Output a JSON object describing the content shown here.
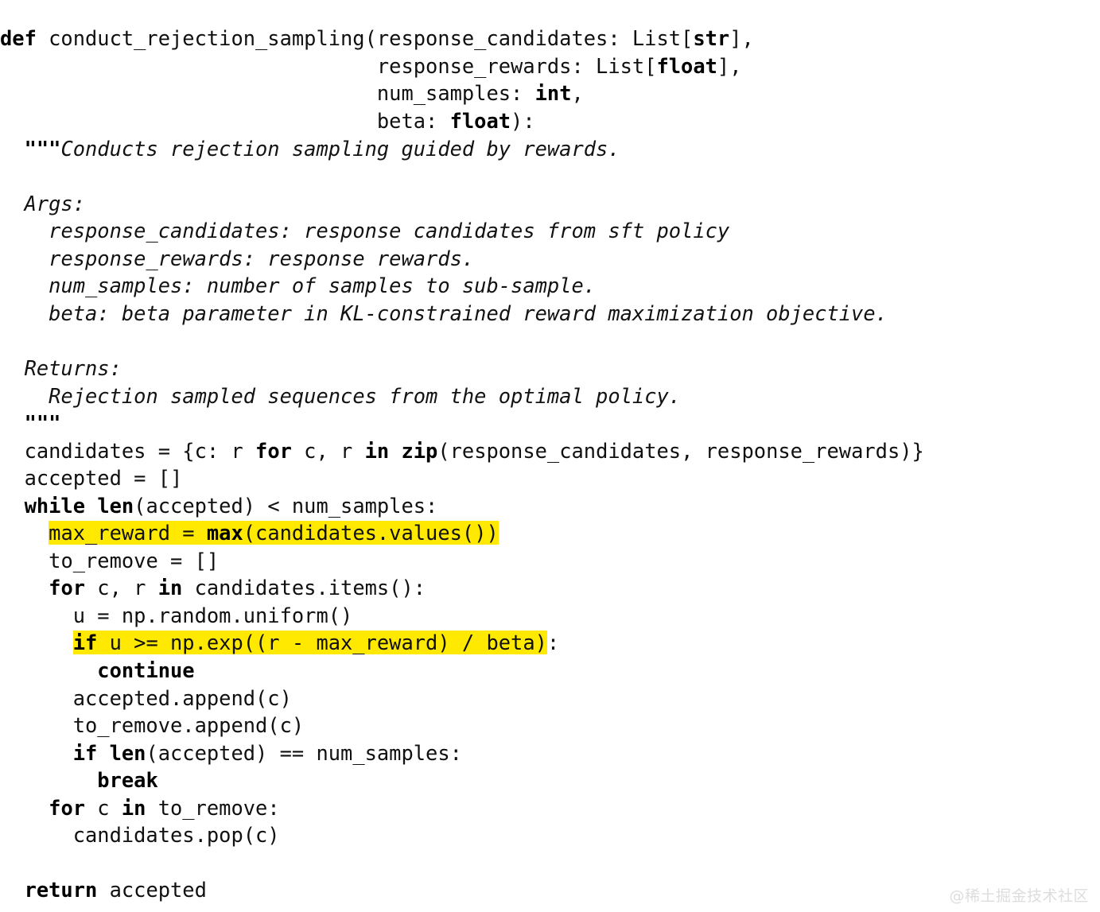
{
  "app": {
    "kind": "code-snippet-image",
    "language": "python",
    "background_color": "#ffffff",
    "text_color": "#101010",
    "highlight_color": "#ffe900"
  },
  "code": {
    "function_name": "conduct_rejection_sampling",
    "lines": [
      {
        "n": 1,
        "indent": 0,
        "text": "def conduct_rejection_sampling(response_candidates: List[str],"
      },
      {
        "n": 2,
        "indent": 31,
        "text": "response_rewards: List[float],"
      },
      {
        "n": 3,
        "indent": 31,
        "text": "num_samples: int,"
      },
      {
        "n": 4,
        "indent": 31,
        "text": "beta: float):"
      },
      {
        "n": 5,
        "indent": 2,
        "text": "\"\"\"Conducts rejection sampling guided by rewards."
      },
      {
        "n": 6,
        "indent": 0,
        "text": ""
      },
      {
        "n": 7,
        "indent": 2,
        "text": "Args:"
      },
      {
        "n": 8,
        "indent": 4,
        "text": "response_candidates: response candidates from sft policy"
      },
      {
        "n": 9,
        "indent": 4,
        "text": "response_rewards: response rewards."
      },
      {
        "n": 10,
        "indent": 4,
        "text": "num_samples: number of samples to sub-sample."
      },
      {
        "n": 11,
        "indent": 4,
        "text": "beta: beta parameter in KL-constrained reward maximization objective."
      },
      {
        "n": 12,
        "indent": 0,
        "text": ""
      },
      {
        "n": 13,
        "indent": 2,
        "text": "Returns:"
      },
      {
        "n": 14,
        "indent": 4,
        "text": "Rejection sampled sequences from the optimal policy."
      },
      {
        "n": 15,
        "indent": 2,
        "text": "\"\"\""
      },
      {
        "n": 16,
        "indent": 2,
        "text": "candidates = {c: r for c, r in zip(response_candidates, response_rewards)}"
      },
      {
        "n": 17,
        "indent": 2,
        "text": "accepted = []"
      },
      {
        "n": 18,
        "indent": 2,
        "text": "while len(accepted) < num_samples:"
      },
      {
        "n": 19,
        "indent": 4,
        "text": "max_reward = max(candidates.values())",
        "highlighted": true
      },
      {
        "n": 20,
        "indent": 4,
        "text": "to_remove = []"
      },
      {
        "n": 21,
        "indent": 4,
        "text": "for c, r in candidates.items():"
      },
      {
        "n": 22,
        "indent": 6,
        "text": "u = np.random.uniform()"
      },
      {
        "n": 23,
        "indent": 6,
        "text": "if u >= np.exp((r - max_reward) / beta):",
        "highlighted": true
      },
      {
        "n": 24,
        "indent": 8,
        "text": "continue"
      },
      {
        "n": 25,
        "indent": 6,
        "text": "accepted.append(c)"
      },
      {
        "n": 26,
        "indent": 6,
        "text": "to_remove.append(c)"
      },
      {
        "n": 27,
        "indent": 6,
        "text": "if len(accepted) == num_samples:"
      },
      {
        "n": 28,
        "indent": 8,
        "text": "break"
      },
      {
        "n": 29,
        "indent": 4,
        "text": "for c in to_remove:"
      },
      {
        "n": 30,
        "indent": 6,
        "text": "candidates.pop(c)"
      },
      {
        "n": 31,
        "indent": 0,
        "text": ""
      },
      {
        "n": 32,
        "indent": 2,
        "text": "return accepted"
      }
    ],
    "keywords_bold": [
      "def",
      "str",
      "float",
      "int",
      "for",
      "in",
      "zip",
      "while",
      "len",
      "max",
      "if",
      "continue",
      "break",
      "return"
    ],
    "highlighted_lines": [
      19,
      23
    ],
    "segments": {
      "l1_kw": "def",
      "l1_a": " conduct_rejection_sampling(response_candidates: List[",
      "l1_kw2": "str",
      "l1_b": "],",
      "l2_a": "response_rewards: List[",
      "l2_kw": "float",
      "l2_b": "],",
      "l3_a": "num_samples: ",
      "l3_kw": "int",
      "l3_b": ",",
      "l4_a": "beta: ",
      "l4_kw": "float",
      "l4_b": "):",
      "l5_q": "\"\"\"",
      "l5_doc": "Conducts rejection sampling guided by rewards.",
      "l7_doc": "Args:",
      "l8_doc": "response_candidates: response candidates from sft policy",
      "l9_doc": "response_rewards: response rewards.",
      "l10_doc": "num_samples: number of samples to sub-sample.",
      "l11_doc": "beta: beta parameter in KL-constrained reward maximization objective.",
      "l13_doc": "Returns:",
      "l14_doc": "Rejection sampled sequences from the optimal policy.",
      "l15_q": "\"\"\"",
      "l16_a": "candidates = {c: r ",
      "l16_kw1": "for",
      "l16_b": " c, r ",
      "l16_kw2": "in",
      "l16_c": " ",
      "l16_kw3": "zip",
      "l16_d": "(response_candidates, response_rewards)}",
      "l17_a": "accepted = []",
      "l18_kw1": "while",
      "l18_a": " ",
      "l18_kw2": "len",
      "l18_b": "(accepted) < num_samples:",
      "l19_a": "max_reward = ",
      "l19_kw": "max",
      "l19_b": "(candidates.values())",
      "l20_a": "to_remove = []",
      "l21_kw1": "for",
      "l21_a": " c, r ",
      "l21_kw2": "in",
      "l21_b": " candidates.items():",
      "l22_a": "u = np.random.uniform()",
      "l23_kw": "if",
      "l23_a": " u >= np.exp((r - max_reward) / beta)",
      "l23_tail": ":",
      "l24_kw": "continue",
      "l25_a": "accepted.append(c)",
      "l26_a": "to_remove.append(c)",
      "l27_kw1": "if",
      "l27_a": " ",
      "l27_kw2": "len",
      "l27_b": "(accepted) == num_samples:",
      "l28_kw": "break",
      "l29_kw1": "for",
      "l29_a": " c ",
      "l29_kw2": "in",
      "l29_b": " to_remove:",
      "l30_a": "candidates.pop(c)",
      "l32_kw": "return",
      "l32_a": " accepted"
    }
  },
  "watermark": {
    "text": "@稀土掘金技术社区"
  }
}
